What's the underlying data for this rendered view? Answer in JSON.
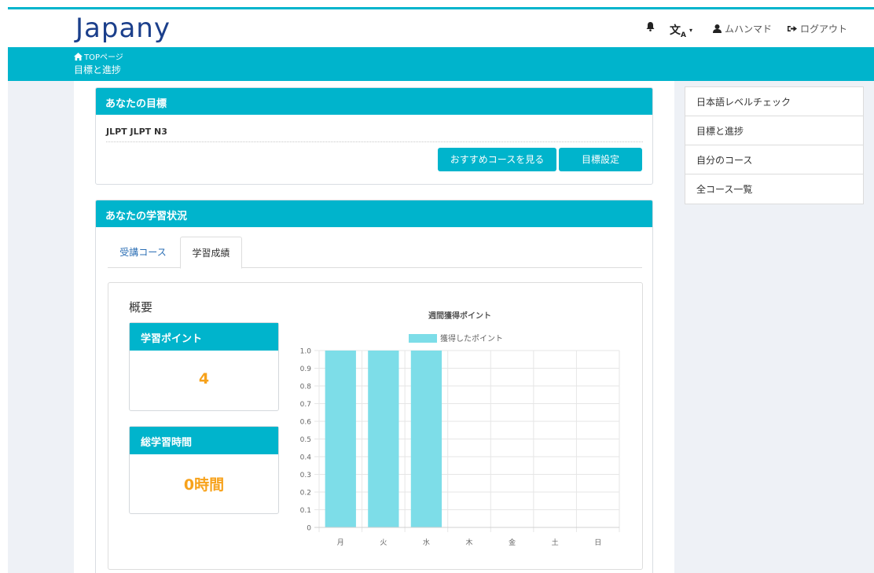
{
  "header": {
    "logo": "Japany",
    "user_name": "ムハンマド",
    "logout_label": "ログアウト"
  },
  "breadcrumb": {
    "home_label": "TOPページ",
    "current": "目標と進捗"
  },
  "goal_panel": {
    "title": "あなたの目標",
    "goal_text": "JLPT JLPT N3",
    "recommend_button": "おすすめコースを見る",
    "set_goal_button": "目標設定"
  },
  "study_panel": {
    "title": "あなたの学習状況",
    "tabs": [
      {
        "label": "受講コース",
        "active": false
      },
      {
        "label": "学習成績",
        "active": true
      }
    ],
    "overview_title": "概要",
    "points_card": {
      "title": "学習ポイント",
      "value": "4"
    },
    "time_card": {
      "title": "総学習時間",
      "value": "0時間"
    }
  },
  "sidebar": {
    "items": [
      {
        "label": "日本語レベルチェック"
      },
      {
        "label": "目標と進捗"
      },
      {
        "label": "自分のコース"
      },
      {
        "label": "全コース一覧"
      }
    ]
  },
  "colors": {
    "accent": "#00b4cc",
    "bar": "#7ddde8",
    "stat_value": "#f7a21b",
    "logo": "#1b3f8b"
  },
  "chart_data": {
    "type": "bar",
    "title": "週間獲得ポイント",
    "categories": [
      "月",
      "火",
      "水",
      "木",
      "金",
      "土",
      "日"
    ],
    "series": [
      {
        "name": "獲得したポイント",
        "values": [
          1,
          1,
          1,
          0,
          0,
          0,
          0
        ]
      }
    ],
    "ylim": [
      0,
      1.0
    ],
    "yticks": [
      "0",
      "0.1",
      "0.2",
      "0.3",
      "0.4",
      "0.5",
      "0.6",
      "0.7",
      "0.8",
      "0.9",
      "1.0"
    ],
    "grid": true,
    "legend": "top"
  }
}
